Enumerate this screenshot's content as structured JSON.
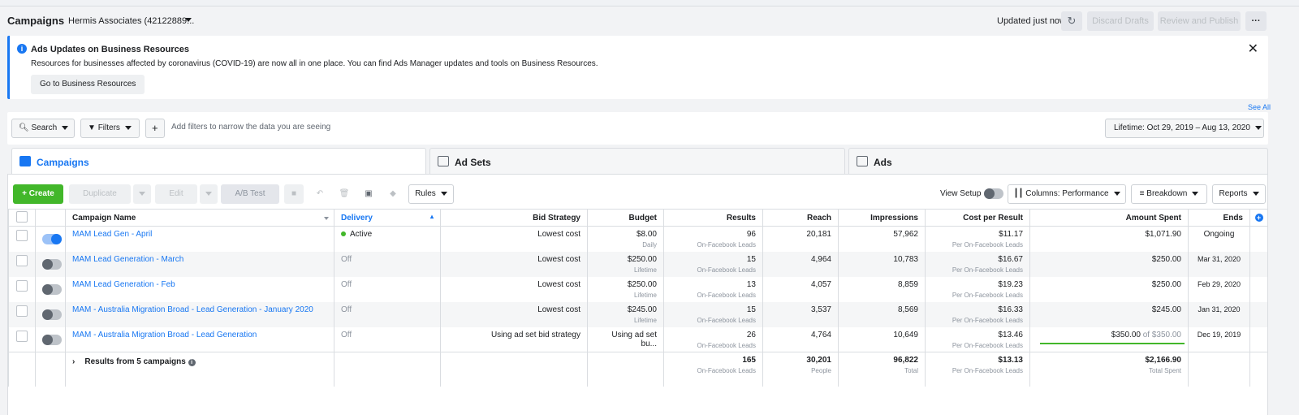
{
  "header": {
    "title": "Campaigns",
    "account": "Hermis Associates (42122889...",
    "updated": "Updated just now",
    "discard": "Discard Drafts",
    "review": "Review and Publish",
    "more": "···"
  },
  "banner": {
    "title": "Ads Updates on Business Resources",
    "body": "Resources for businesses affected by coronavirus (COVID-19) are now all in one place. You can find Ads Manager updates and tools on Business Resources.",
    "button": "Go to Business Resources",
    "see_all": "See All"
  },
  "filterbar": {
    "search": "Search",
    "filters": "Filters",
    "hint": "Add filters to narrow the data you are seeing",
    "date": "Lifetime: Oct 29, 2019 – Aug 13, 2020"
  },
  "tabs": [
    "Campaigns",
    "Ad Sets",
    "Ads"
  ],
  "toolbar": {
    "create": "Create",
    "duplicate": "Duplicate",
    "edit": "Edit",
    "abtest": "A/B Test",
    "rules": "Rules",
    "view_setup": "View Setup",
    "columns": "Columns: Performance",
    "breakdown": "Breakdown",
    "reports": "Reports"
  },
  "columns": [
    "Campaign Name",
    "Delivery",
    "Bid Strategy",
    "Budget",
    "Results",
    "Reach",
    "Impressions",
    "Cost per Result",
    "Amount Spent",
    "Ends"
  ],
  "rows": [
    {
      "on": true,
      "name": "MAM Lead Gen - April",
      "delivery": "Active",
      "bid": "Lowest cost",
      "budget": "$8.00",
      "budget_sub": "Daily",
      "results": "96",
      "results_sub": "On-Facebook Leads",
      "reach": "20,181",
      "impressions": "57,962",
      "cpr": "$11.17",
      "cpr_sub": "Per On-Facebook Leads",
      "spent": "$1,071.90",
      "ends": "Ongoing"
    },
    {
      "on": false,
      "name": "MAM Lead Generation - March",
      "delivery": "Off",
      "bid": "Lowest cost",
      "budget": "$250.00",
      "budget_sub": "Lifetime",
      "results": "15",
      "results_sub": "On-Facebook Leads",
      "reach": "4,964",
      "impressions": "10,783",
      "cpr": "$16.67",
      "cpr_sub": "Per On-Facebook Leads",
      "spent": "$250.00",
      "ends": "Mar 31, 2020"
    },
    {
      "on": false,
      "name": "MAM Lead Generation - Feb",
      "delivery": "Off",
      "bid": "Lowest cost",
      "budget": "$250.00",
      "budget_sub": "Lifetime",
      "results": "13",
      "results_sub": "On-Facebook Leads",
      "reach": "4,057",
      "impressions": "8,859",
      "cpr": "$19.23",
      "cpr_sub": "Per On-Facebook Leads",
      "spent": "$250.00",
      "ends": "Feb 29, 2020"
    },
    {
      "on": false,
      "name": "MAM - Australia Migration Broad - Lead Generation - January 2020",
      "delivery": "Off",
      "bid": "Lowest cost",
      "budget": "$245.00",
      "budget_sub": "Lifetime",
      "results": "15",
      "results_sub": "On-Facebook Leads",
      "reach": "3,537",
      "impressions": "8,569",
      "cpr": "$16.33",
      "cpr_sub": "Per On-Facebook Leads",
      "spent": "$245.00",
      "ends": "Jan 31, 2020"
    },
    {
      "on": false,
      "name": "MAM - Australia Migration Broad - Lead Generation",
      "delivery": "Off",
      "bid": "Using ad set bid strategy",
      "budget": "Using ad set bu...",
      "budget_sub": "",
      "results": "26",
      "results_sub": "On-Facebook Leads",
      "reach": "4,764",
      "impressions": "10,649",
      "cpr": "$13.46",
      "cpr_sub": "Per On-Facebook Leads",
      "spent": "$350.00",
      "spent_of": " of $350.00",
      "spent_fraction": 1.0,
      "ends": "Dec 19, 2019"
    }
  ],
  "total": {
    "label": "Results from 5 campaigns",
    "results": "165",
    "results_sub": "On-Facebook Leads",
    "reach": "30,201",
    "reach_sub": "People",
    "impressions": "96,822",
    "impressions_sub": "Total",
    "cpr": "$13.13",
    "cpr_sub": "Per On-Facebook Leads",
    "spent": "$2,166.90",
    "spent_sub": "Total Spent"
  },
  "colors": {
    "accent": "#1877f2",
    "create": "#42b72a",
    "active_dot": "#42b72a"
  }
}
